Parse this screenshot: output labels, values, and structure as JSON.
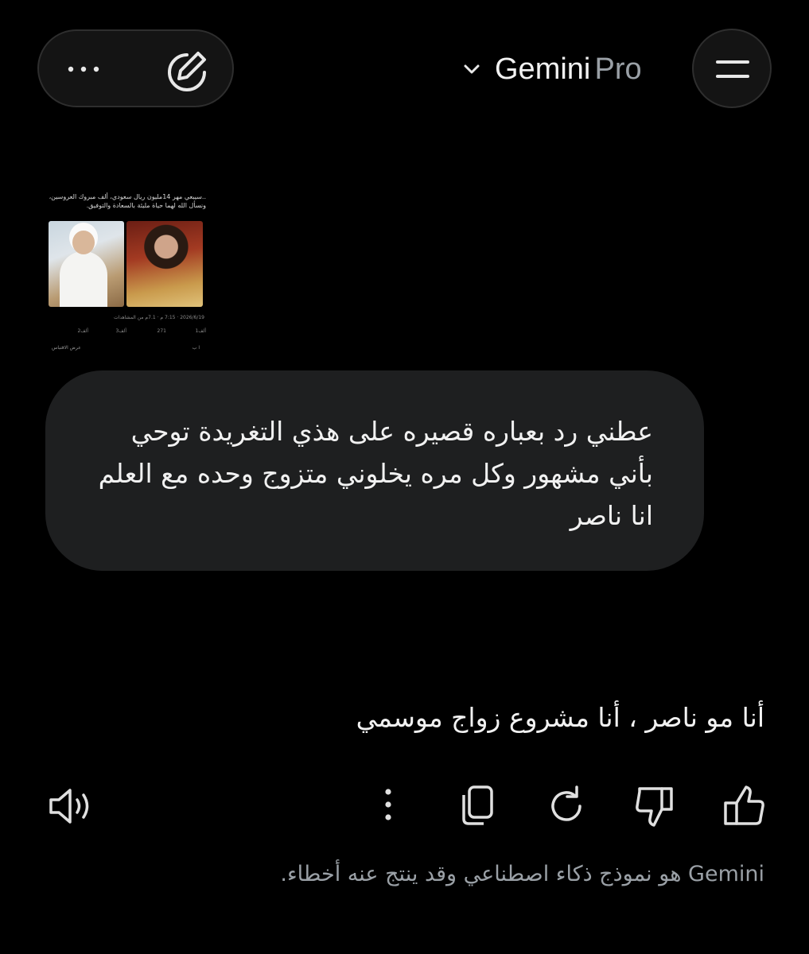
{
  "header": {
    "title": "Gemini",
    "tier": "Pro",
    "more_icon": "more-horizontal-icon",
    "edit_icon": "new-chat-pen-icon",
    "menu_icon": "menu-icon"
  },
  "attachment": {
    "tweet_text": "..سيبعي مهر 14مليون ريال سعودي، ألف مبروك العروسين، ونسأل الله لهما حياة مليئة بالسعادة والتوفيق.",
    "meta": "2026/6/19 · 7:15 م · 7.1م من المشاهدات",
    "replies": "1ألف",
    "reposts": "271",
    "likes": "3ألف",
    "bookmarks": "2ألف",
    "foot_right": "ا ب",
    "foot_left": "عرض الاقتباس"
  },
  "messages": {
    "user": "عطني رد بعباره قصيره على هذي التغريدة توحي بأني مشهور وكل مره يخلوني متزوج وحده مع العلم انا ناصر",
    "model": "أنا مو ناصر ، أنا مشروع زواج موسمي"
  },
  "actions": {
    "listen": "speaker-icon",
    "more": "more-vertical-icon",
    "copy": "copy-icon",
    "regenerate": "refresh-icon",
    "dislike": "thumbs-down-icon",
    "like": "thumbs-up-icon"
  },
  "footer": {
    "disclaimer": "Gemini هو نموذج ذكاء اصطناعي وقد ينتج عنه أخطاء."
  }
}
